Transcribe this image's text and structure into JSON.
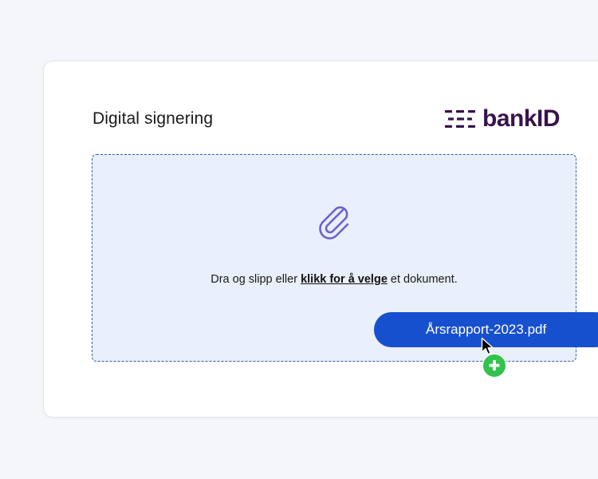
{
  "header": {
    "title": "Digital signering",
    "brand": "bankID"
  },
  "dropzone": {
    "text_before": "Dra og slipp eller ",
    "link_label": "klikk for å velge",
    "text_after": " et dokument.",
    "icon": "paperclip-icon"
  },
  "dragged_file": {
    "name": "Årsrapport-2023.pdf",
    "cursor_icon": "arrow-cursor-icon",
    "badge_icon": "plus-icon"
  },
  "colors": {
    "background": "#f5f6fa",
    "card": "#ffffff",
    "dropzone_fill": "#e9effb",
    "dropzone_border": "#2f5fb9",
    "brand": "#39134c",
    "file_chip": "#1750cf",
    "add_badge": "#33c24d",
    "clip_icon": "#6b62c9"
  }
}
